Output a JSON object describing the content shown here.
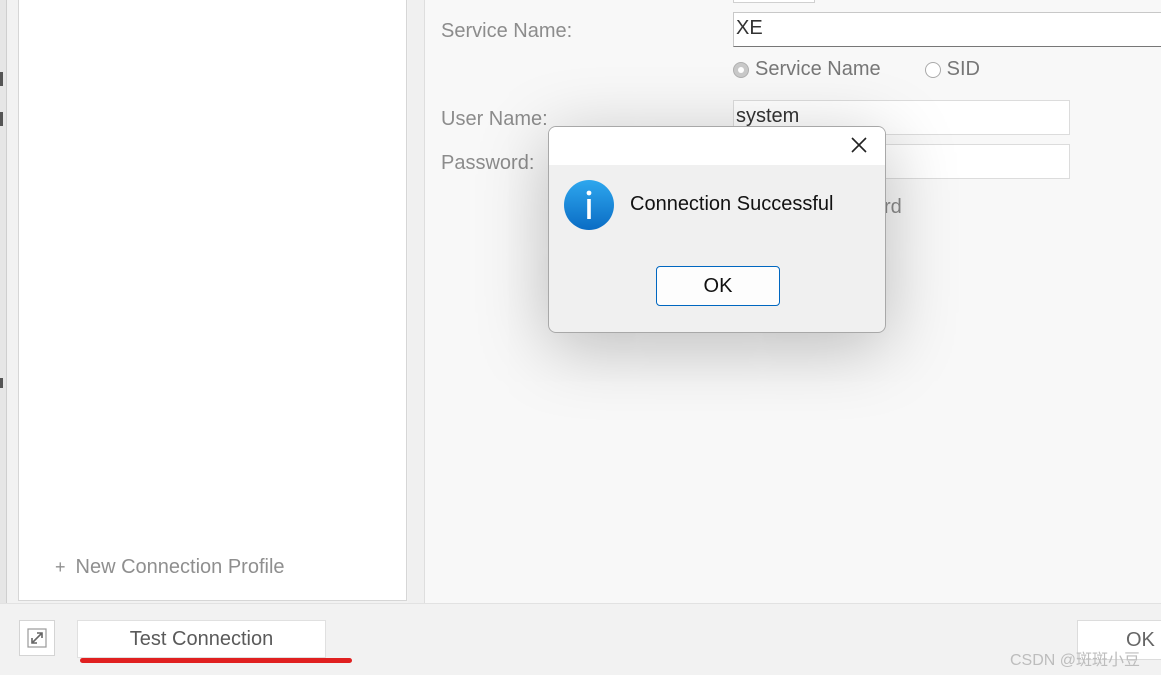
{
  "form": {
    "service_name_label": "Service Name:",
    "service_name_value": "XE",
    "radio_service_name": "Service Name",
    "radio_sid": "SID",
    "radio_selected": "Service Name",
    "user_name_label": "User Name:",
    "user_name_value": "system",
    "password_label": "Password:",
    "save_password_partial": "rd"
  },
  "sidebar": {
    "new_profile_plus": "+",
    "new_profile_label": "New Connection Profile"
  },
  "footer": {
    "test_connection_label": "Test Connection",
    "ok_label": "OK",
    "watermark": "CSDN @斑斑小豆",
    "highlight_color": "#e02020"
  },
  "dialog": {
    "message": "Connection Successful",
    "ok_label": "OK",
    "icon": "info-icon",
    "close_icon": "close-icon",
    "accent": "#0067c0"
  }
}
